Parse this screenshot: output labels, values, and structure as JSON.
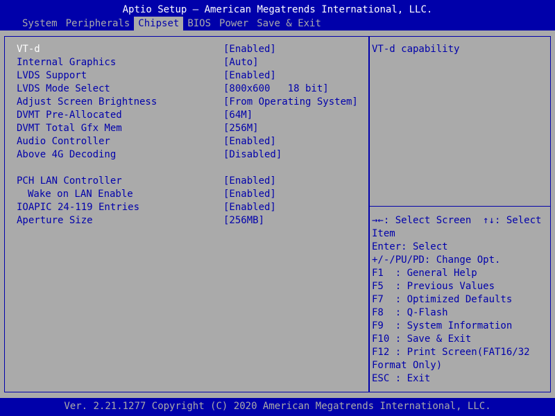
{
  "header": {
    "title": "Aptio Setup – American Megatrends International, LLC.",
    "tabs": [
      {
        "label": "System"
      },
      {
        "label": "Peripherals"
      },
      {
        "label": "Chipset"
      },
      {
        "label": "BIOS"
      },
      {
        "label": "Power"
      },
      {
        "label": "Save & Exit"
      }
    ],
    "active_tab": "Chipset"
  },
  "settings": [
    {
      "label": "VT-d",
      "value": "[Enabled]"
    },
    {
      "label": "Internal Graphics",
      "value": "[Auto]"
    },
    {
      "label": "LVDS Support",
      "value": "[Enabled]"
    },
    {
      "label": "LVDS Mode Select",
      "value": "[800x600   18 bit]"
    },
    {
      "label": "Adjust Screen Brightness",
      "value": "[From Operating System]"
    },
    {
      "label": "DVMT Pre-Allocated",
      "value": "[64M]"
    },
    {
      "label": "DVMT Total Gfx Mem",
      "value": "[256M]"
    },
    {
      "label": "Audio Controller",
      "value": "[Enabled]"
    },
    {
      "label": "Above 4G Decoding",
      "value": "[Disabled]"
    },
    {
      "label": "PCH LAN Controller",
      "value": "[Enabled]"
    },
    {
      "label": "Wake on LAN Enable",
      "value": "[Enabled]"
    },
    {
      "label": "IOAPIC 24-119 Entries",
      "value": "[Enabled]"
    },
    {
      "label": "Aperture Size",
      "value": "[256MB]"
    }
  ],
  "selected_item": "VT-d",
  "help": {
    "description": "VT-d capability",
    "keys": [
      "→←: Select Screen  ↑↓: Select",
      "Item",
      "Enter: Select",
      "+/-/PU/PD: Change Opt.",
      "F1  : General Help",
      "F5  : Previous Values",
      "F7  : Optimized Defaults",
      "F8  : Q-Flash",
      "F9  : System Information",
      "F10 : Save & Exit",
      "F12 : Print Screen(FAT16/32",
      "Format Only)",
      "ESC : Exit"
    ]
  },
  "footer": {
    "text": "Ver. 2.21.1277 Copyright (C) 2020 American Megatrends International, LLC."
  },
  "colors": {
    "background": "#aaaaaa",
    "bar": "#0000aa",
    "text": "#0000aa",
    "highlight": "#ffffff"
  }
}
